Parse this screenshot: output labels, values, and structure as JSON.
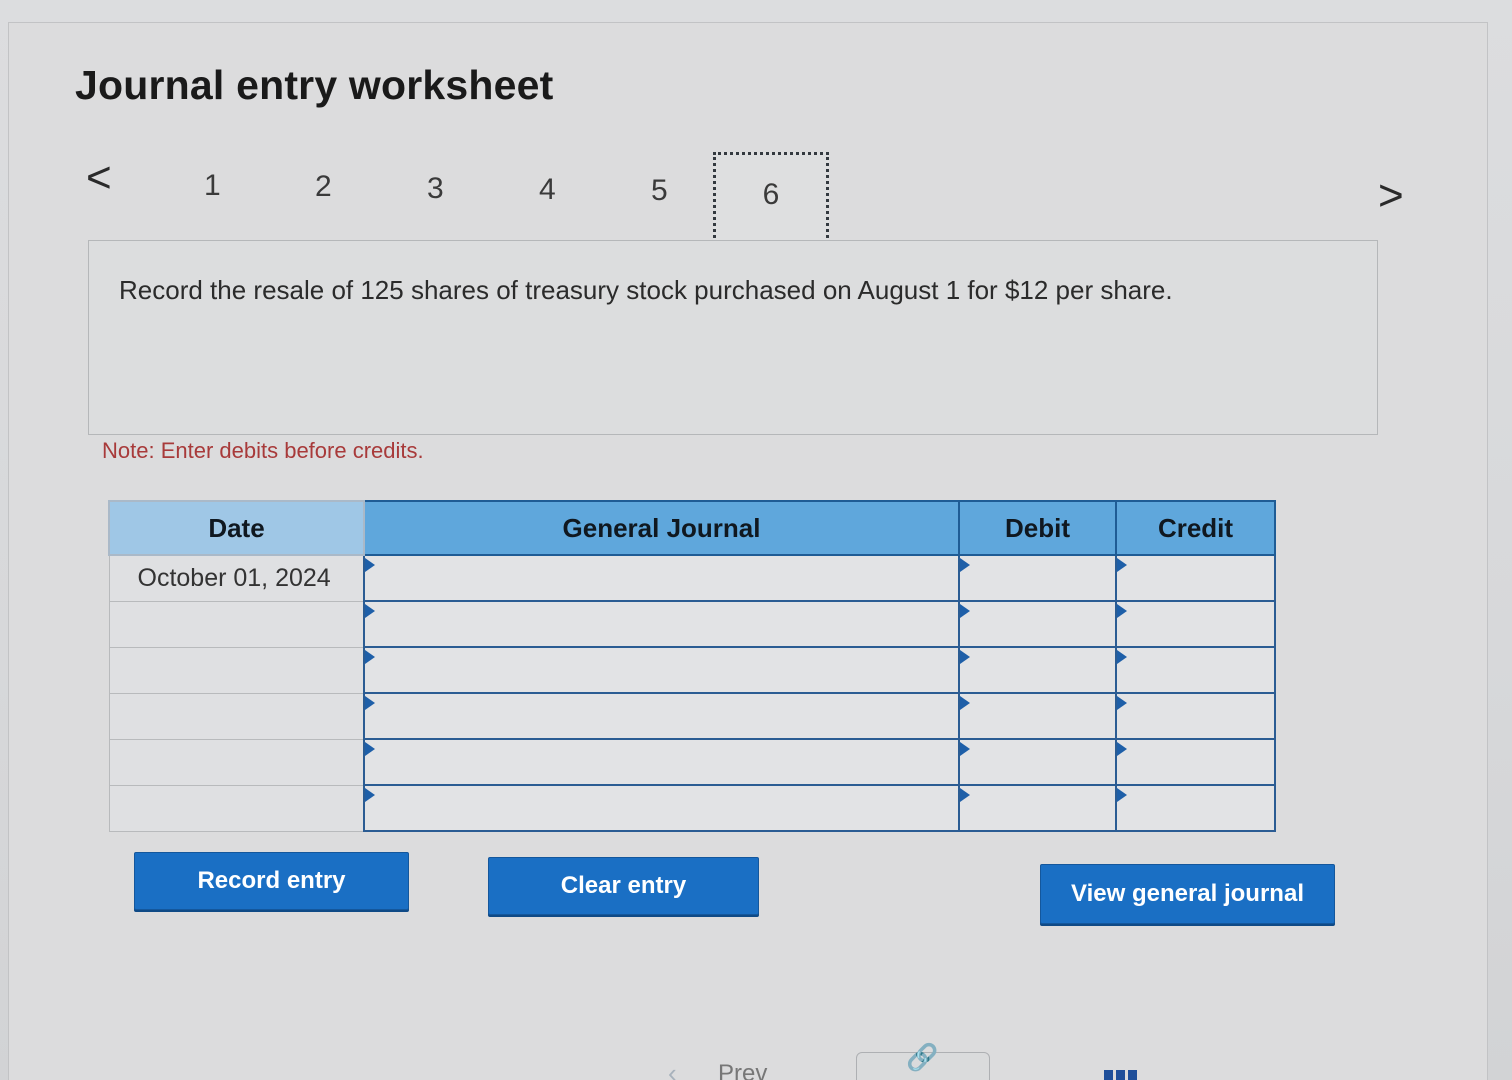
{
  "header": {
    "title": "Journal entry worksheet"
  },
  "steps": {
    "items": [
      "1",
      "2",
      "3",
      "4",
      "5",
      "6"
    ],
    "active": "6"
  },
  "nav": {
    "prev_glyph": "<",
    "next_glyph": ">"
  },
  "question": {
    "text": "Record the resale of 125 shares of treasury stock purchased on August 1 for $12 per share."
  },
  "note": "Note: Enter debits before credits.",
  "table": {
    "columns": [
      "Date",
      "General Journal",
      "Debit",
      "Credit"
    ],
    "rows": [
      {
        "date": "October 01, 2024",
        "account": "",
        "debit": "",
        "credit": ""
      },
      {
        "date": "",
        "account": "",
        "debit": "",
        "credit": ""
      },
      {
        "date": "",
        "account": "",
        "debit": "",
        "credit": ""
      },
      {
        "date": "",
        "account": "",
        "debit": "",
        "credit": ""
      },
      {
        "date": "",
        "account": "",
        "debit": "",
        "credit": ""
      },
      {
        "date": "",
        "account": "",
        "debit": "",
        "credit": ""
      }
    ]
  },
  "buttons": {
    "record": "Record entry",
    "clear": "Clear entry",
    "view": "View general journal"
  },
  "footer": {
    "prev": "Prev"
  },
  "colors": {
    "header_blue": "#5fa7dc",
    "button_blue": "#1a6fc4",
    "note_red": "#a83a3a"
  }
}
